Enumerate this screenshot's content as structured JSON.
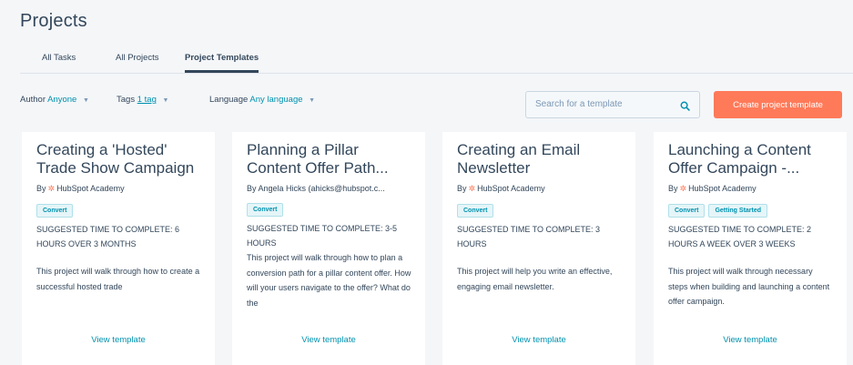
{
  "page": {
    "title": "Projects"
  },
  "tabs": [
    {
      "label": "All Tasks"
    },
    {
      "label": "All Projects"
    },
    {
      "label": "Project Templates",
      "active": true
    }
  ],
  "filters": {
    "author": {
      "label": "Author",
      "value": "Anyone"
    },
    "tags": {
      "label": "Tags",
      "value": "1 tag"
    },
    "language": {
      "label": "Language",
      "value": "Any language"
    }
  },
  "search": {
    "placeholder": "Search for a template",
    "value": ""
  },
  "create_button": {
    "label": "Create project template",
    "color": "#ff7a59"
  },
  "colors": {
    "accent": "#0091ae",
    "text": "#33475b",
    "brand": "#ff7a59"
  },
  "cards": [
    {
      "title": "Creating a 'Hosted' Trade Show Campaign",
      "author_prefix": "By",
      "author": "HubSpot Academy",
      "show_logo": true,
      "tags": [
        "Convert"
      ],
      "time": "SUGGESTED TIME TO COMPLETE: 6 HOURS OVER 3 MONTHS",
      "description": "This project will walk through how to create a successful hosted trade",
      "link": "View template"
    },
    {
      "title": "Planning a Pillar Content Offer Path...",
      "author_prefix": "By",
      "author": "Angela Hicks (ahicks@hubspot.c...",
      "show_logo": false,
      "tags": [
        "Convert"
      ],
      "time": "SUGGESTED TIME TO COMPLETE: 3-5 HOURS",
      "description": "This project will walk through how to plan a conversion path for a pillar content offer. How will your users navigate to the offer? What do the",
      "link": "View template"
    },
    {
      "title": "Creating an Email Newsletter",
      "author_prefix": "By",
      "author": "HubSpot Academy",
      "show_logo": true,
      "tags": [
        "Convert"
      ],
      "time": "SUGGESTED TIME TO COMPLETE: 3 HOURS",
      "description": "This project will help you write an effective, engaging email newsletter.",
      "link": "View template"
    },
    {
      "title": "Launching a Content Offer Campaign -...",
      "author_prefix": "By",
      "author": "HubSpot Academy",
      "show_logo": true,
      "tags": [
        "Convert",
        "Getting Started"
      ],
      "time": "SUGGESTED TIME TO COMPLETE: 2 HOURS A WEEK OVER 3 WEEKS",
      "description": "This project will walk through necessary steps  when building and launching a content offer campaign.",
      "link": "View template"
    }
  ]
}
